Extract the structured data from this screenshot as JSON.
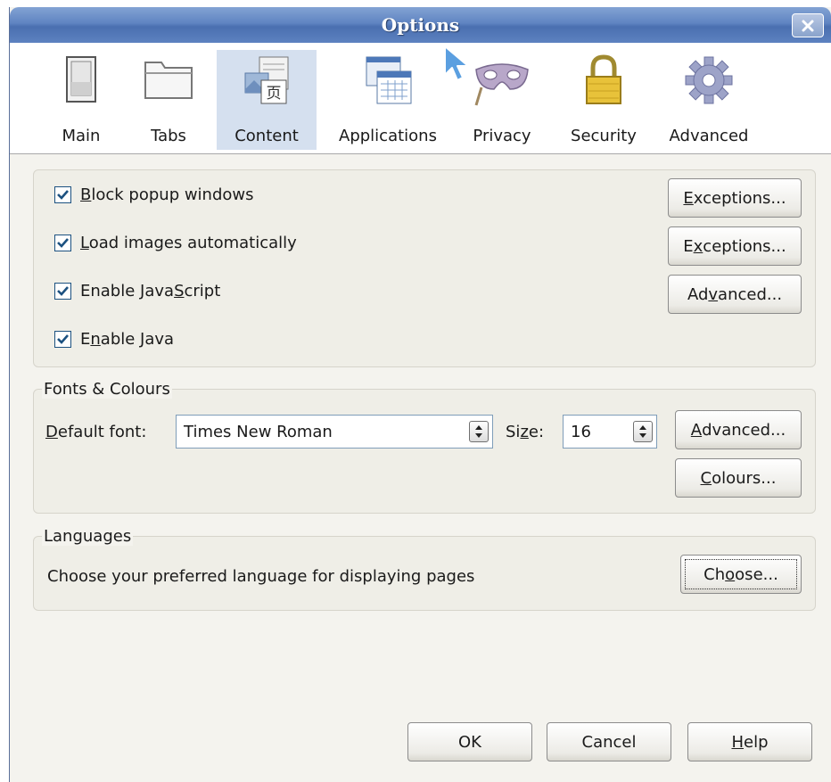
{
  "window": {
    "title": "Options"
  },
  "panes": [
    {
      "id": "main",
      "label": "Main"
    },
    {
      "id": "tabs",
      "label": "Tabs"
    },
    {
      "id": "content",
      "label": "Content",
      "selected": true
    },
    {
      "id": "applications",
      "label": "Applications"
    },
    {
      "id": "privacy",
      "label": "Privacy"
    },
    {
      "id": "security",
      "label": "Security"
    },
    {
      "id": "advanced",
      "label": "Advanced"
    }
  ],
  "content": {
    "checks": [
      {
        "pre": "",
        "key": "B",
        "post": "lock popup windows",
        "checked": true,
        "button": {
          "pre": "",
          "key": "E",
          "post": "xceptions..."
        }
      },
      {
        "pre": "",
        "key": "L",
        "post": "oad images automatically",
        "checked": true,
        "button": {
          "pre": "E",
          "key": "x",
          "post": "ceptions..."
        }
      },
      {
        "pre": "Enable Java",
        "key": "S",
        "post": "cript",
        "checked": true,
        "button": {
          "pre": "Ad",
          "key": "v",
          "post": "anced..."
        }
      },
      {
        "pre": "E",
        "key": "n",
        "post": "able Java",
        "checked": true
      }
    ],
    "fonts": {
      "caption": "Fonts & Colours",
      "default_font_label": {
        "pre": "",
        "key": "D",
        "post": "efault font:"
      },
      "default_font_value": "Times New Roman",
      "size_label": {
        "pre": "Si",
        "key": "z",
        "post": "e:"
      },
      "size_value": "16",
      "advanced_button": {
        "pre": "",
        "key": "A",
        "post": "dvanced..."
      },
      "colours_button": {
        "pre": "",
        "key": "C",
        "post": "olours..."
      }
    },
    "languages": {
      "caption": "Languages",
      "description": "Choose your preferred language for displaying pages",
      "choose_button": {
        "pre": "Ch",
        "key": "o",
        "post": "ose..."
      }
    }
  },
  "footer": {
    "ok": "OK",
    "cancel": "Cancel",
    "help": {
      "pre": "",
      "key": "H",
      "post": "elp"
    }
  },
  "colors": {
    "titlebar": "#5f84c2",
    "selected_pane": "#d5e0ef",
    "checkbox_mark": "#1c5180"
  }
}
